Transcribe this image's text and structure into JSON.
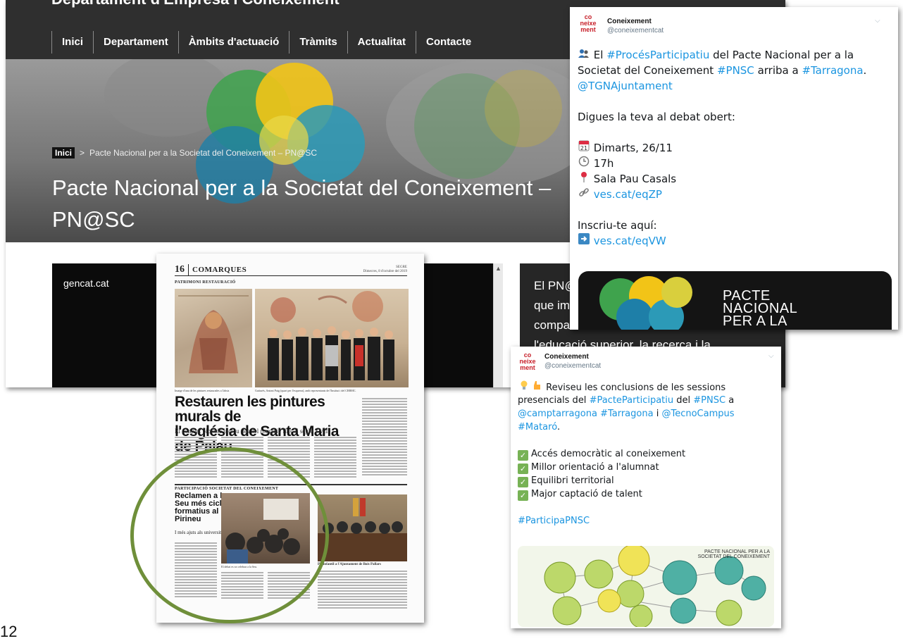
{
  "website": {
    "title": "Departament d'Empresa i Coneixement",
    "nav": [
      "Inici",
      "Departament",
      "Àmbits d'actuació",
      "Tràmits",
      "Actualitat",
      "Contacte"
    ],
    "breadcrumb": {
      "home": "Inici",
      "separator": ">",
      "current": "Pacte Nacional per a la Societat del Coneixement – PN@SC"
    },
    "hero_title_line1": "Pacte Nacional per a la Societat del Coneixement –",
    "hero_title_line2": "PN@SC",
    "video_label": "gencat.cat",
    "side_text": [
      "El PN@",
      "que im",
      "compartida entre l'àmbit de",
      "l'educació superior, la recerca i la"
    ]
  },
  "newspaper": {
    "page_number": "16",
    "section": "COMARQUES",
    "masthead": "SEGRE",
    "masthead_date": "Dimecres, 8 d'octubre del 2019",
    "category1": "PATRIMONI RESTAURACIÓ",
    "caption1": "Imatge d'una de les pintures restaurades a l'absis",
    "caption2": "Gutiurès, Antoni Puig (quart per l'esquerra), amb representants de l'Institut i del CRBMC.",
    "headline_line1": "Restauren les pintures murals de",
    "headline_line2": "l'església de Santa Maria de Palau",
    "subheadline": "El conjunt pictòric inclou des del romànic fins al segle XVII",
    "category2": "PARTICIPACIÓ SOCIETAT DEL CONEIXEMENT",
    "article2_title": "Reclamen a la Seu més cicles formatius al Pirineu",
    "article2_sub": "I més ajuts als universitaris",
    "caption3": "El debat es va celebrar a la Seu.",
    "caption4": "Ple infantil a l'Ajuntament de Bois Pallars"
  },
  "tweet1": {
    "avatar_top": "co",
    "avatar_mid": "neixe",
    "avatar_bottom": "ment",
    "name": "Coneixement",
    "handle": "@coneixementcat",
    "l1_pre": "El ",
    "l1_tag": "#ProcésParticipatiu",
    "l1_post": " del Pacte Nacional per a la",
    "l2_pre": "Societat del Coneixement ",
    "l2_tag1": "#PNSC",
    "l2_mid": " arriba a ",
    "l2_tag2": "#Tarragona",
    "l2_post": ".",
    "l3_mention": "@TGNAjuntament",
    "l4": "Digues la teva al debat obert:",
    "date": "Dimarts, 26/11",
    "time": "17h",
    "place": "Sala Pau Casals",
    "link1": "ves.cat/eqZP",
    "register": "Inscriu-te aquí:",
    "link2": "ves.cat/eqVW",
    "calendar_num": "21",
    "banner_l1": "PACTE",
    "banner_l2": "NACIONAL",
    "banner_l3": "PER A LA"
  },
  "tweet2": {
    "avatar_top": "co",
    "avatar_mid": "neixe",
    "avatar_bottom": "ment",
    "name": "Coneixement",
    "handle": "@coneixementcat",
    "l1": "Reviseu les conclusions de les sessions",
    "l2_pre": "presencials del ",
    "l2_tag1": "#PacteParticipatiu",
    "l2_mid": " del ",
    "l2_tag2": "#PNSC",
    "l2_post": " a",
    "l3_tag1": "@camptarragona",
    "l3_tag2": "#Tarragona",
    "l3_mid": " i ",
    "l3_tag3": "@TecnoCampus",
    "l4_tag": "#Mataró",
    "l4_post": ".",
    "items": [
      "Accés democràtic al coneixement",
      "Millor orientació a l'alumnat",
      "Equilibri territorial",
      "Major captació de talent"
    ],
    "hashtag": "#ParticipaPNSC",
    "map_title_l1": "PACTE NACIONAL PER A LA",
    "map_title_l2": "SOCIETAT DEL CONEIXEMENT"
  },
  "page_number": "12",
  "colors": {
    "link": "#1b95e0",
    "header_dark": "#2f2f2f",
    "highlight_circle": "#6f8f3a",
    "check_green": "#77b255",
    "brand_red": "#c7202a"
  }
}
